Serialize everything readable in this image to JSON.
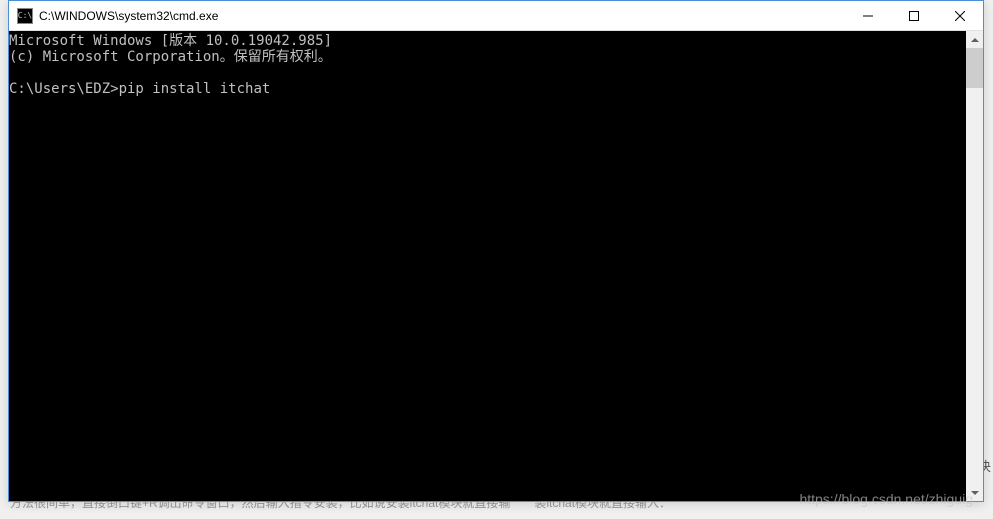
{
  "background": {
    "bottom_text": "方法很间单，直接倒口键+R调出命令窗口，然后输入指令安装，比如说安装itchat模块就直接输　　装itchat模块就直接输入：",
    "right_text": "决"
  },
  "window": {
    "title": "C:\\WINDOWS\\system32\\cmd.exe",
    "icon_text": "C:\\"
  },
  "terminal": {
    "line1": "Microsoft Windows [版本 10.0.19042.985]",
    "line2": "(c) Microsoft Corporation。保留所有权利。",
    "line3": "",
    "prompt": "C:\\Users\\EDZ>",
    "command": "pip install itchat"
  },
  "watermark": "https://blog.csdn.net/zhiguig"
}
